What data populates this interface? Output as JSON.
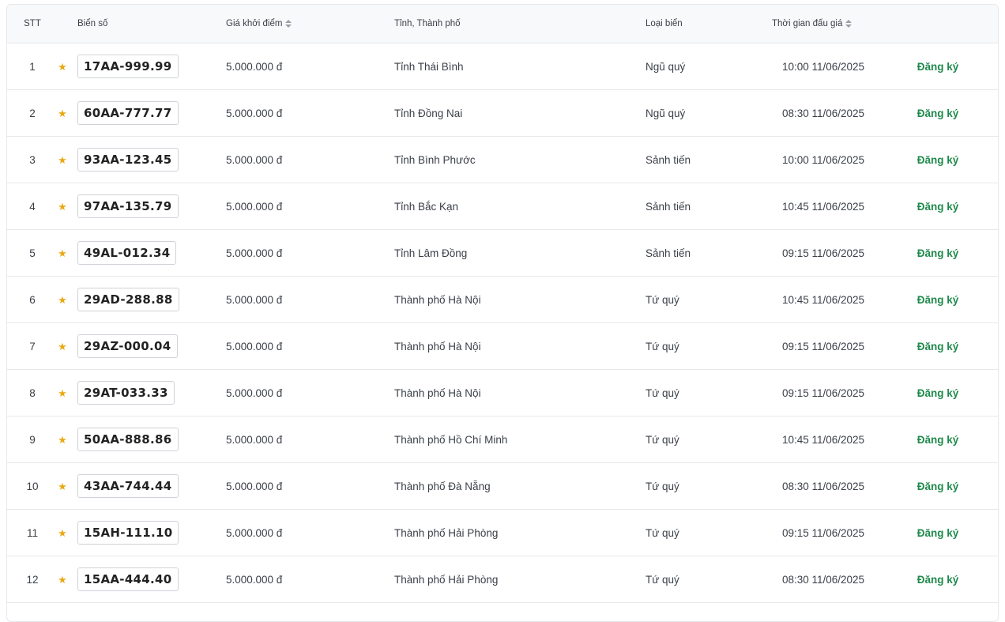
{
  "columns": {
    "stt": "STT",
    "plate": "Biển số",
    "price": "Giá khởi điểm",
    "province": "Tỉnh, Thành phố",
    "type": "Loại biển",
    "time": "Thời gian đấu giá"
  },
  "icons": {
    "star": "★",
    "star_color": "#e8a912",
    "register_color": "#1f8a4c"
  },
  "rows": [
    {
      "stt": "1",
      "plate": "17AA-999.99",
      "price": "5.000.000 đ",
      "province": "Tỉnh Thái Bình",
      "type": "Ngũ quý",
      "time": "10:00 11/06/2025",
      "action": "Đăng ký"
    },
    {
      "stt": "2",
      "plate": "60AA-777.77",
      "price": "5.000.000 đ",
      "province": "Tỉnh Đồng Nai",
      "type": "Ngũ quý",
      "time": "08:30 11/06/2025",
      "action": "Đăng ký"
    },
    {
      "stt": "3",
      "plate": "93AA-123.45",
      "price": "5.000.000 đ",
      "province": "Tỉnh Bình Phước",
      "type": "Sảnh tiến",
      "time": "10:00 11/06/2025",
      "action": "Đăng ký"
    },
    {
      "stt": "4",
      "plate": "97AA-135.79",
      "price": "5.000.000 đ",
      "province": "Tỉnh Bắc Kạn",
      "type": "Sảnh tiến",
      "time": "10:45 11/06/2025",
      "action": "Đăng ký"
    },
    {
      "stt": "5",
      "plate": "49AL-012.34",
      "price": "5.000.000 đ",
      "province": "Tỉnh Lâm Đồng",
      "type": "Sảnh tiến",
      "time": "09:15 11/06/2025",
      "action": "Đăng ký"
    },
    {
      "stt": "6",
      "plate": "29AD-288.88",
      "price": "5.000.000 đ",
      "province": "Thành phố Hà Nội",
      "type": "Tứ quý",
      "time": "10:45 11/06/2025",
      "action": "Đăng ký"
    },
    {
      "stt": "7",
      "plate": "29AZ-000.04",
      "price": "5.000.000 đ",
      "province": "Thành phố Hà Nội",
      "type": "Tứ quý",
      "time": "09:15 11/06/2025",
      "action": "Đăng ký"
    },
    {
      "stt": "8",
      "plate": "29AT-033.33",
      "price": "5.000.000 đ",
      "province": "Thành phố Hà Nội",
      "type": "Tứ quý",
      "time": "09:15 11/06/2025",
      "action": "Đăng ký"
    },
    {
      "stt": "9",
      "plate": "50AA-888.86",
      "price": "5.000.000 đ",
      "province": "Thành phố Hồ Chí Minh",
      "type": "Tứ quý",
      "time": "10:45 11/06/2025",
      "action": "Đăng ký"
    },
    {
      "stt": "10",
      "plate": "43AA-744.44",
      "price": "5.000.000 đ",
      "province": "Thành phố Đà Nẵng",
      "type": "Tứ quý",
      "time": "08:30 11/06/2025",
      "action": "Đăng ký"
    },
    {
      "stt": "11",
      "plate": "15AH-111.10",
      "price": "5.000.000 đ",
      "province": "Thành phố Hải Phòng",
      "type": "Tứ quý",
      "time": "09:15 11/06/2025",
      "action": "Đăng ký"
    },
    {
      "stt": "12",
      "plate": "15AA-444.40",
      "price": "5.000.000 đ",
      "province": "Thành phố Hải Phòng",
      "type": "Tứ quý",
      "time": "08:30 11/06/2025",
      "action": "Đăng ký"
    }
  ]
}
